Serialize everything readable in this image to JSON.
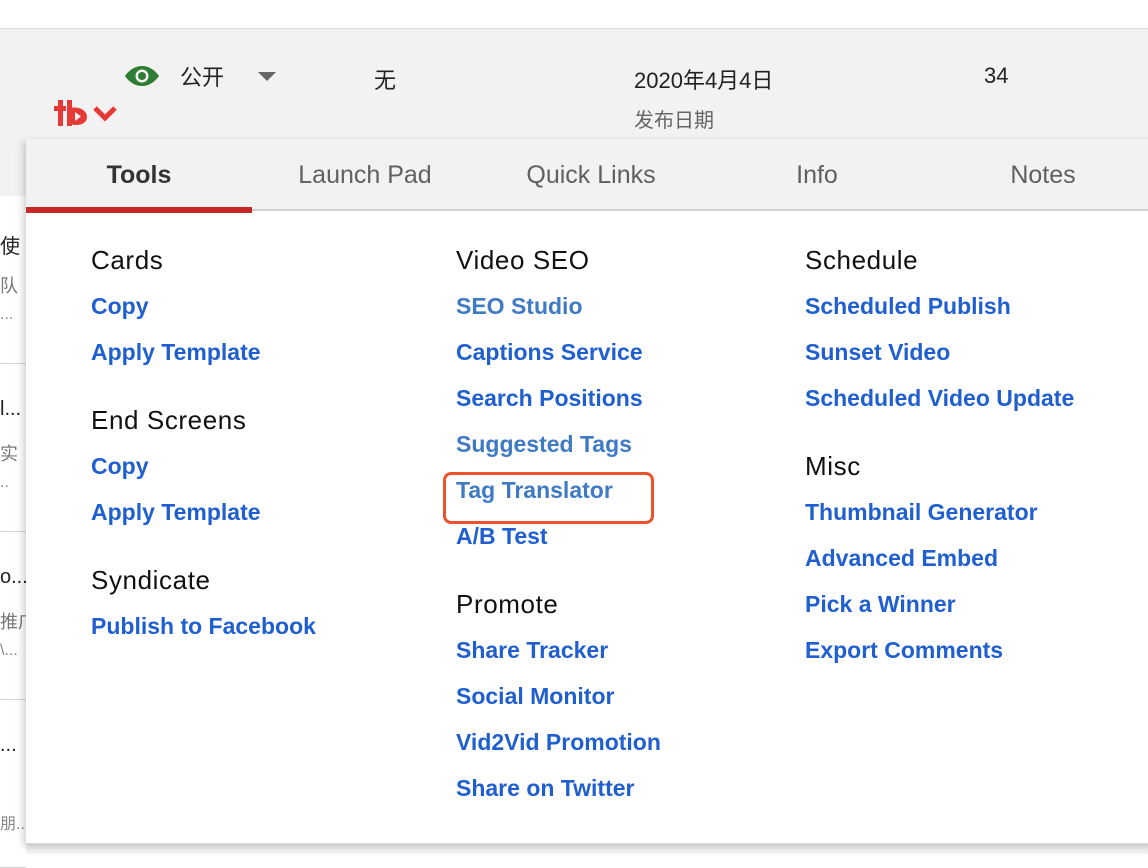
{
  "video_row": {
    "visibility_label": "公开",
    "restrictions_value": "无",
    "date_value": "2020年4月4日",
    "date_label": "发布日期",
    "views_value": "34",
    "eye_color": "#2e7d32"
  },
  "extension": {
    "logo_icon": "tubebuddy-logo-icon",
    "brand_color": "#e53935"
  },
  "background_rows": [
    {
      "line1": "使",
      "line2": "队",
      "line3": "..."
    },
    {
      "line1": "l...",
      "line2": "实",
      "line3": ".."
    },
    {
      "line1": "o...",
      "line2": "推广",
      "line3": "\\..."
    },
    {
      "line1": "...",
      "line2": "",
      "line3": "朋.."
    }
  ],
  "tabs": [
    {
      "label": "Tools",
      "active": true
    },
    {
      "label": "Launch Pad",
      "active": false
    },
    {
      "label": "Quick Links",
      "active": false
    },
    {
      "label": "Info",
      "active": false
    },
    {
      "label": "Notes",
      "active": false
    }
  ],
  "columns": [
    {
      "sections": [
        {
          "title": "Cards",
          "links": [
            "Copy",
            "Apply Template"
          ]
        },
        {
          "title": "End Screens",
          "links": [
            "Copy",
            "Apply Template"
          ]
        },
        {
          "title": "Syndicate",
          "links": [
            "Publish to Facebook"
          ]
        }
      ]
    },
    {
      "sections": [
        {
          "title": "Video SEO",
          "links": [
            "SEO Studio",
            "Captions Service",
            "Search Positions",
            "Suggested Tags",
            "Tag Translator",
            "A/B Test"
          ]
        },
        {
          "title": "Promote",
          "links": [
            "Share Tracker",
            "Social Monitor",
            "Vid2Vid Promotion",
            "Share on Twitter"
          ]
        }
      ]
    },
    {
      "sections": [
        {
          "title": "Schedule",
          "links": [
            "Scheduled Publish",
            "Sunset Video",
            "Scheduled Video Update"
          ]
        },
        {
          "title": "Misc",
          "links": [
            "Thumbnail Generator",
            "Advanced Embed",
            "Pick a Winner",
            "Export Comments"
          ]
        }
      ]
    }
  ],
  "highlighted_link": "Tag Translator",
  "colors": {
    "link": "#1f5fcf",
    "active_tab_underline": "#c62828",
    "highlight_box": "#e8532b"
  }
}
